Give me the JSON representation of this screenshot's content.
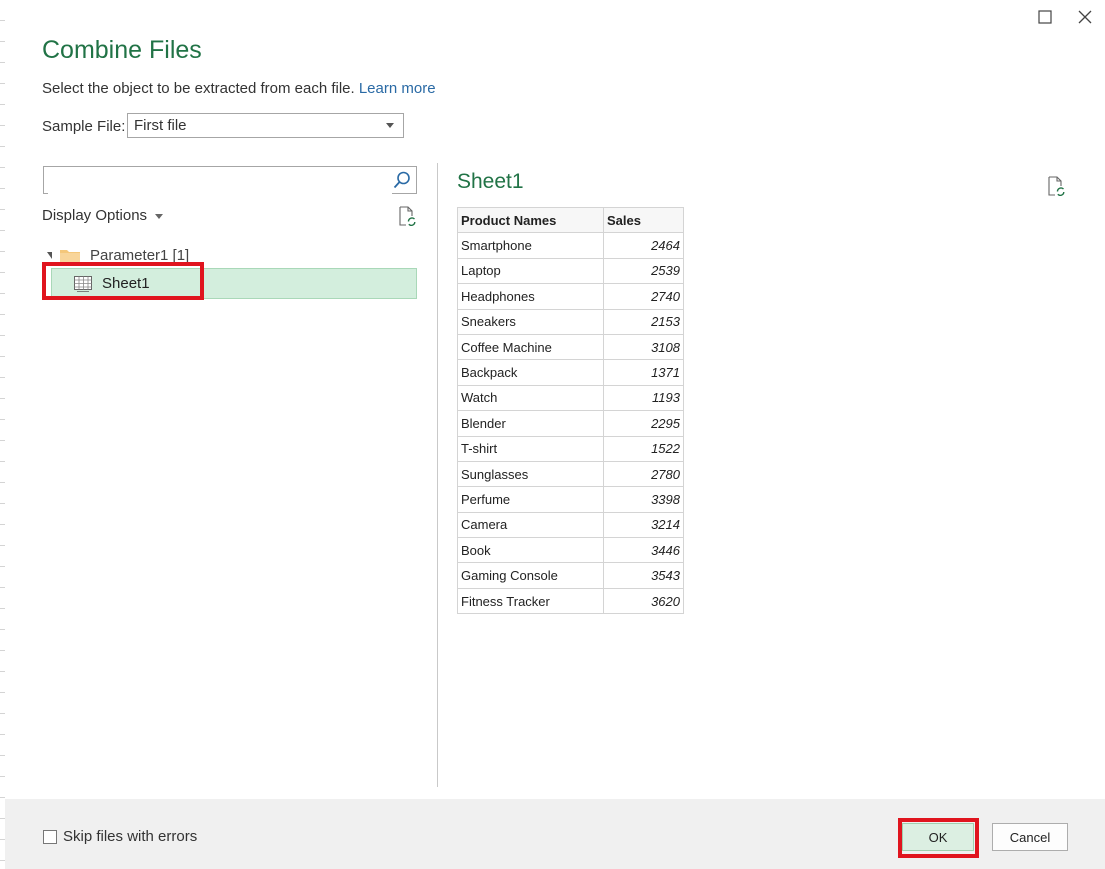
{
  "dialog": {
    "title": "Combine Files",
    "subtitle": "Select the object to be extracted from each file.",
    "learn_more": "Learn more",
    "sample_file_label": "Sample File:",
    "sample_file_value": "First file"
  },
  "navigator": {
    "search_placeholder": "",
    "display_options": "Display Options",
    "folder_label": "Parameter1 [1]",
    "selected_item": "Sheet1"
  },
  "preview": {
    "title": "Sheet1",
    "columns": [
      "Product Names",
      "Sales"
    ],
    "rows": [
      [
        "Smartphone",
        "2464"
      ],
      [
        "Laptop",
        "2539"
      ],
      [
        "Headphones",
        "2740"
      ],
      [
        "Sneakers",
        "2153"
      ],
      [
        "Coffee Machine",
        "3108"
      ],
      [
        "Backpack",
        "1371"
      ],
      [
        "Watch",
        "1193"
      ],
      [
        "Blender",
        "2295"
      ],
      [
        "T-shirt",
        "1522"
      ],
      [
        "Sunglasses",
        "2780"
      ],
      [
        "Perfume",
        "3398"
      ],
      [
        "Camera",
        "3214"
      ],
      [
        "Book",
        "3446"
      ],
      [
        "Gaming Console",
        "3543"
      ],
      [
        "Fitness Tracker",
        "3620"
      ]
    ]
  },
  "footer": {
    "skip_label": "Skip files with errors",
    "skip_checked": false,
    "ok_label": "OK",
    "cancel_label": "Cancel"
  },
  "colors": {
    "accent_green": "#217346",
    "link_blue": "#2a6aa5",
    "selection_bg": "#d3eedd",
    "highlight_red": "#e0141e"
  }
}
